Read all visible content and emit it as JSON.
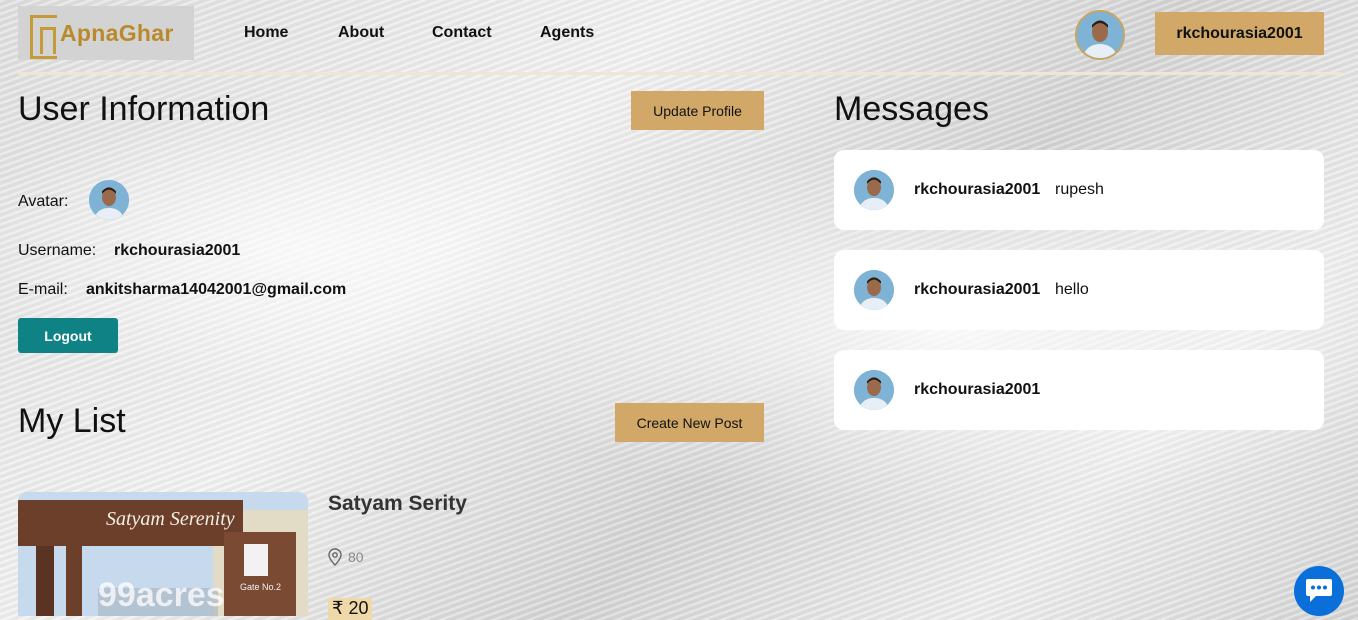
{
  "brand": {
    "name": "ApnaGhar"
  },
  "nav": {
    "links": [
      "Home",
      "About",
      "Contact",
      "Agents"
    ],
    "user_button": "rkchourasia2001"
  },
  "user_info": {
    "title": "User Information",
    "update_button": "Update Profile",
    "avatar_label": "Avatar:",
    "username_label": "Username:",
    "username": "rkchourasia2001",
    "email_label": "E-mail:",
    "email": "ankitsharma14042001@gmail.com",
    "logout_button": "Logout"
  },
  "my_list": {
    "title": "My List",
    "create_button": "Create New Post",
    "posts": [
      {
        "title": "Satyam Serity",
        "location": "80",
        "price": "₹ 20",
        "image_text": "Satyam Serenity",
        "watermark": "99acres",
        "gate": "Gate No.2"
      }
    ]
  },
  "messages": {
    "title": "Messages",
    "items": [
      {
        "username": "rkchourasia2001",
        "text": "rupesh"
      },
      {
        "username": "rkchourasia2001",
        "text": "hello"
      },
      {
        "username": "rkchourasia2001",
        "text": ""
      }
    ]
  },
  "colors": {
    "gold": "#d1a867",
    "teal": "#0e8285",
    "chat_blue": "#0a6fd8"
  },
  "icons": [
    "home-logo-icon",
    "location-pin-icon",
    "chat-icon"
  ]
}
